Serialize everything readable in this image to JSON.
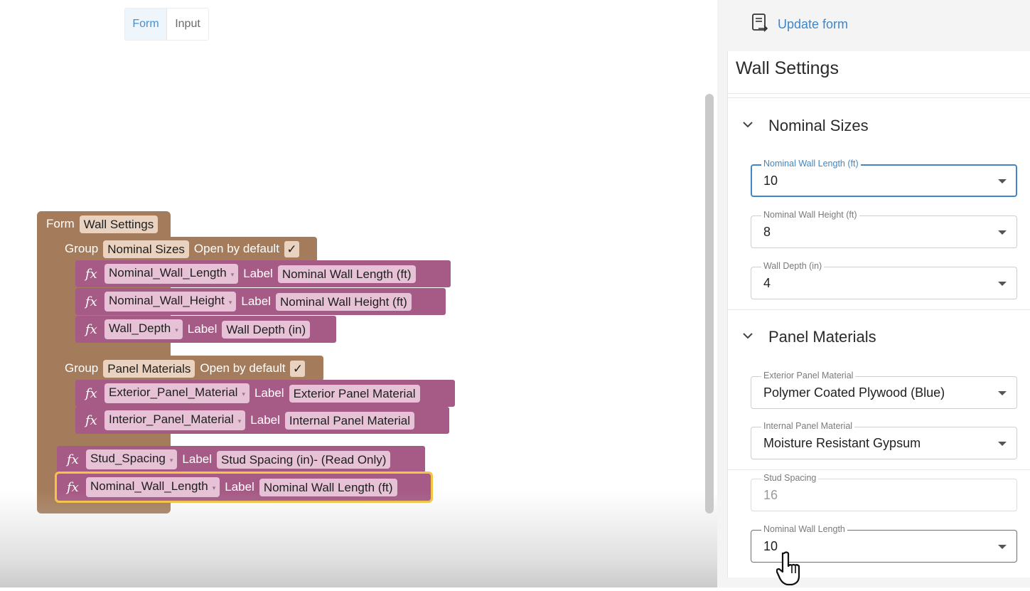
{
  "tabs": [
    {
      "label": "Form",
      "active": true
    },
    {
      "label": "Input",
      "active": false
    }
  ],
  "workspace": {
    "form_label": "Form",
    "form_name": "Wall Settings",
    "groups": [
      {
        "group_label": "Group",
        "name": "Nominal Sizes",
        "open_label": "Open by default",
        "open_checked": "✓",
        "inputs": [
          {
            "fx": "fx",
            "variable": "Nominal_Wall_Length",
            "label_word": "Label",
            "label": "Nominal Wall Length (ft)"
          },
          {
            "fx": "fx",
            "variable": "Nominal_Wall_Height",
            "label_word": "Label",
            "label": "Nominal Wall Height (ft)"
          },
          {
            "fx": "fx",
            "variable": "Wall_Depth",
            "label_word": "Label",
            "label": "Wall Depth (in)"
          }
        ]
      },
      {
        "group_label": "Group",
        "name": "Panel Materials",
        "open_label": "Open by default",
        "open_checked": "✓",
        "inputs": [
          {
            "fx": "fx",
            "variable": "Exterior_Panel_Material",
            "label_word": "Label",
            "label": "Exterior Panel Material"
          },
          {
            "fx": "fx",
            "variable": "Interior_Panel_Material",
            "label_word": "Label",
            "label": "Internal Panel Material"
          }
        ]
      }
    ],
    "loose_inputs": [
      {
        "fx": "fx",
        "variable": "Stud_Spacing",
        "label_word": "Label",
        "label": "Stud Spacing (in)- (Read Only)"
      },
      {
        "fx": "fx",
        "variable": "Nominal_Wall_Length",
        "label_word": "Label",
        "label": "Nominal Wall Length (ft)",
        "selected": true
      }
    ],
    "dropdown_glyph": "▾"
  },
  "panel": {
    "update_label": "Update form",
    "title": "Wall Settings",
    "sections": [
      {
        "title": "Nominal Sizes",
        "fields": [
          {
            "label": "Nominal Wall Length (ft)",
            "value": "10"
          },
          {
            "label": "Nominal Wall Height (ft)",
            "value": "8"
          },
          {
            "label": "Wall Depth (in)",
            "value": "4"
          }
        ]
      },
      {
        "title": "Panel Materials",
        "fields": [
          {
            "label": "Exterior Panel Material",
            "value": "Polymer Coated Plywood (Blue)"
          },
          {
            "label": "Internal Panel Material",
            "value": "Moisture Resistant Gypsum"
          }
        ]
      }
    ],
    "loose_fields": [
      {
        "label": "Stud Spacing",
        "value": "16"
      },
      {
        "label": "Nominal Wall Length",
        "value": "10"
      }
    ]
  },
  "colors": {
    "form_block": "#a57c5b",
    "input_block": "#a65a86",
    "accent": "#3f86c7",
    "selected_outline": "#f5c542"
  }
}
